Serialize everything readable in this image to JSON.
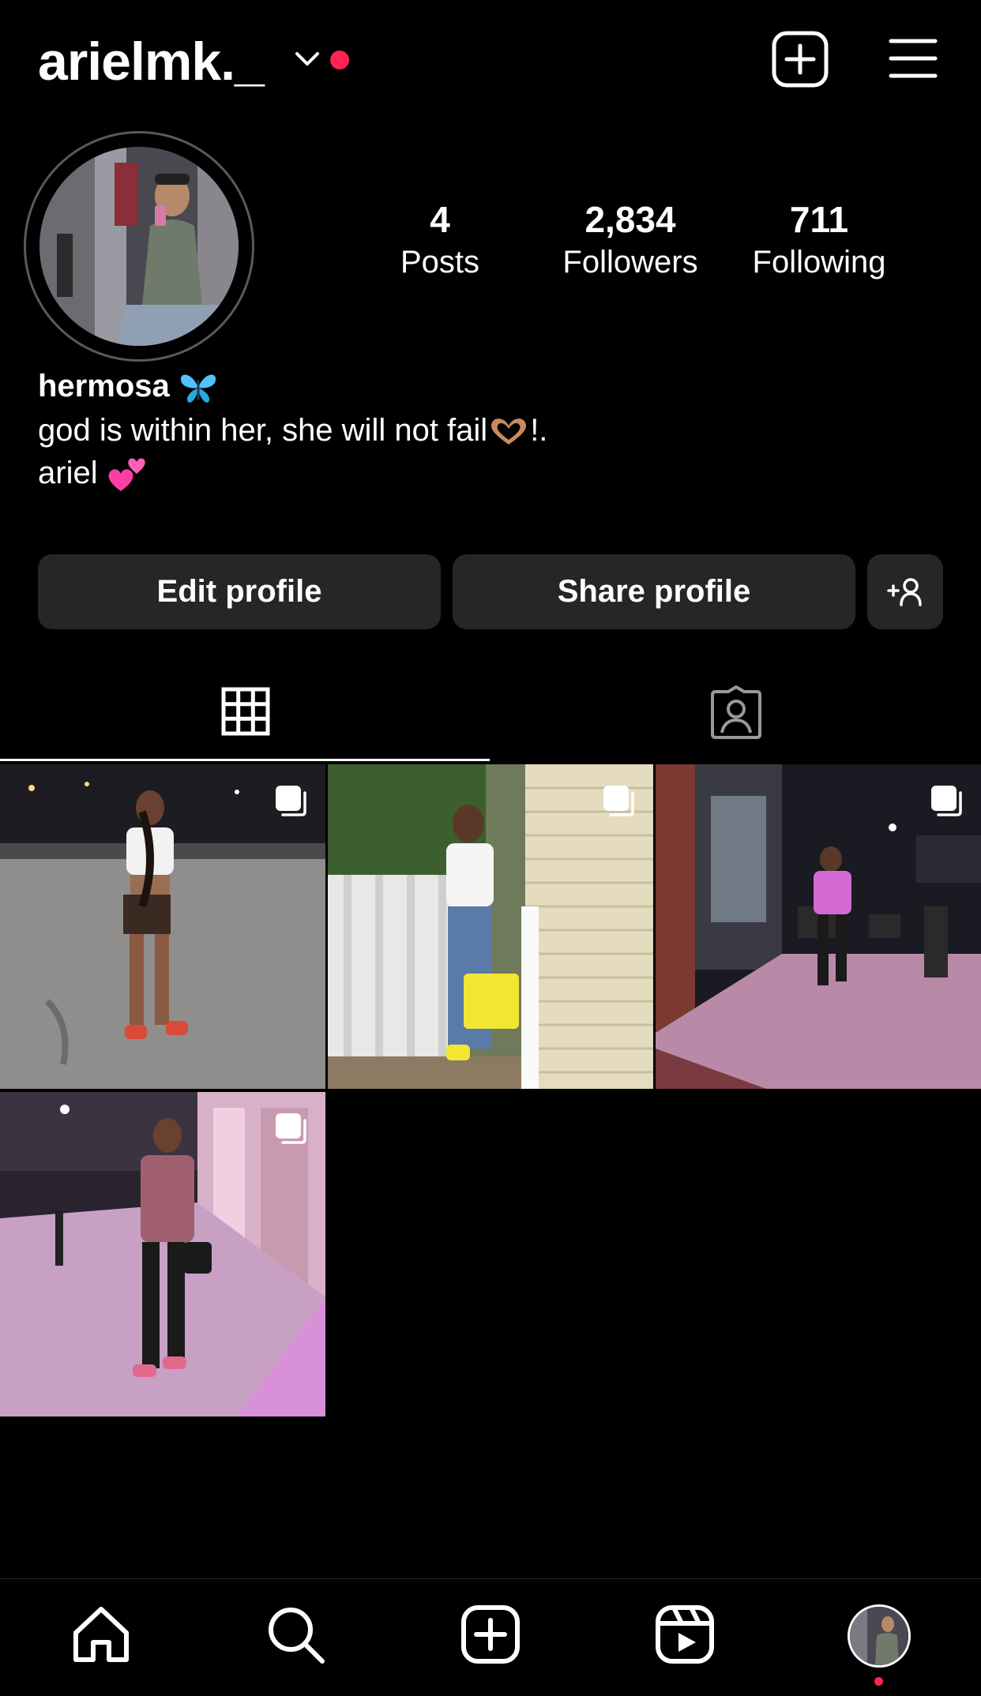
{
  "header": {
    "username": "arielmk._"
  },
  "profile": {
    "stats": [
      {
        "value": "4",
        "label": "Posts"
      },
      {
        "value": "2,834",
        "label": "Followers"
      },
      {
        "value": "711",
        "label": "Following"
      }
    ],
    "display_name": "hermosa",
    "bio_line1": "god is within her, she will not fail",
    "bio_line1_suffix": "!.",
    "bio_line2": "ariel"
  },
  "buttons": {
    "edit": "Edit profile",
    "share": "Share profile"
  },
  "tabs": {
    "active": "grid"
  },
  "posts": [
    {
      "icon": "carousel-icon"
    },
    {
      "icon": "carousel-icon"
    },
    {
      "icon": "carousel-icon"
    },
    {
      "icon": "carousel-icon"
    }
  ],
  "nav": {
    "items": [
      "home-icon",
      "search-icon",
      "create-icon",
      "reels-icon",
      "profile-avatar"
    ]
  },
  "colors": {
    "background": "#000000",
    "button_bg": "#262626",
    "notification_dot": "#ff2451",
    "butterfly": "#4fc3f7",
    "hearts": "#ff3da6"
  }
}
